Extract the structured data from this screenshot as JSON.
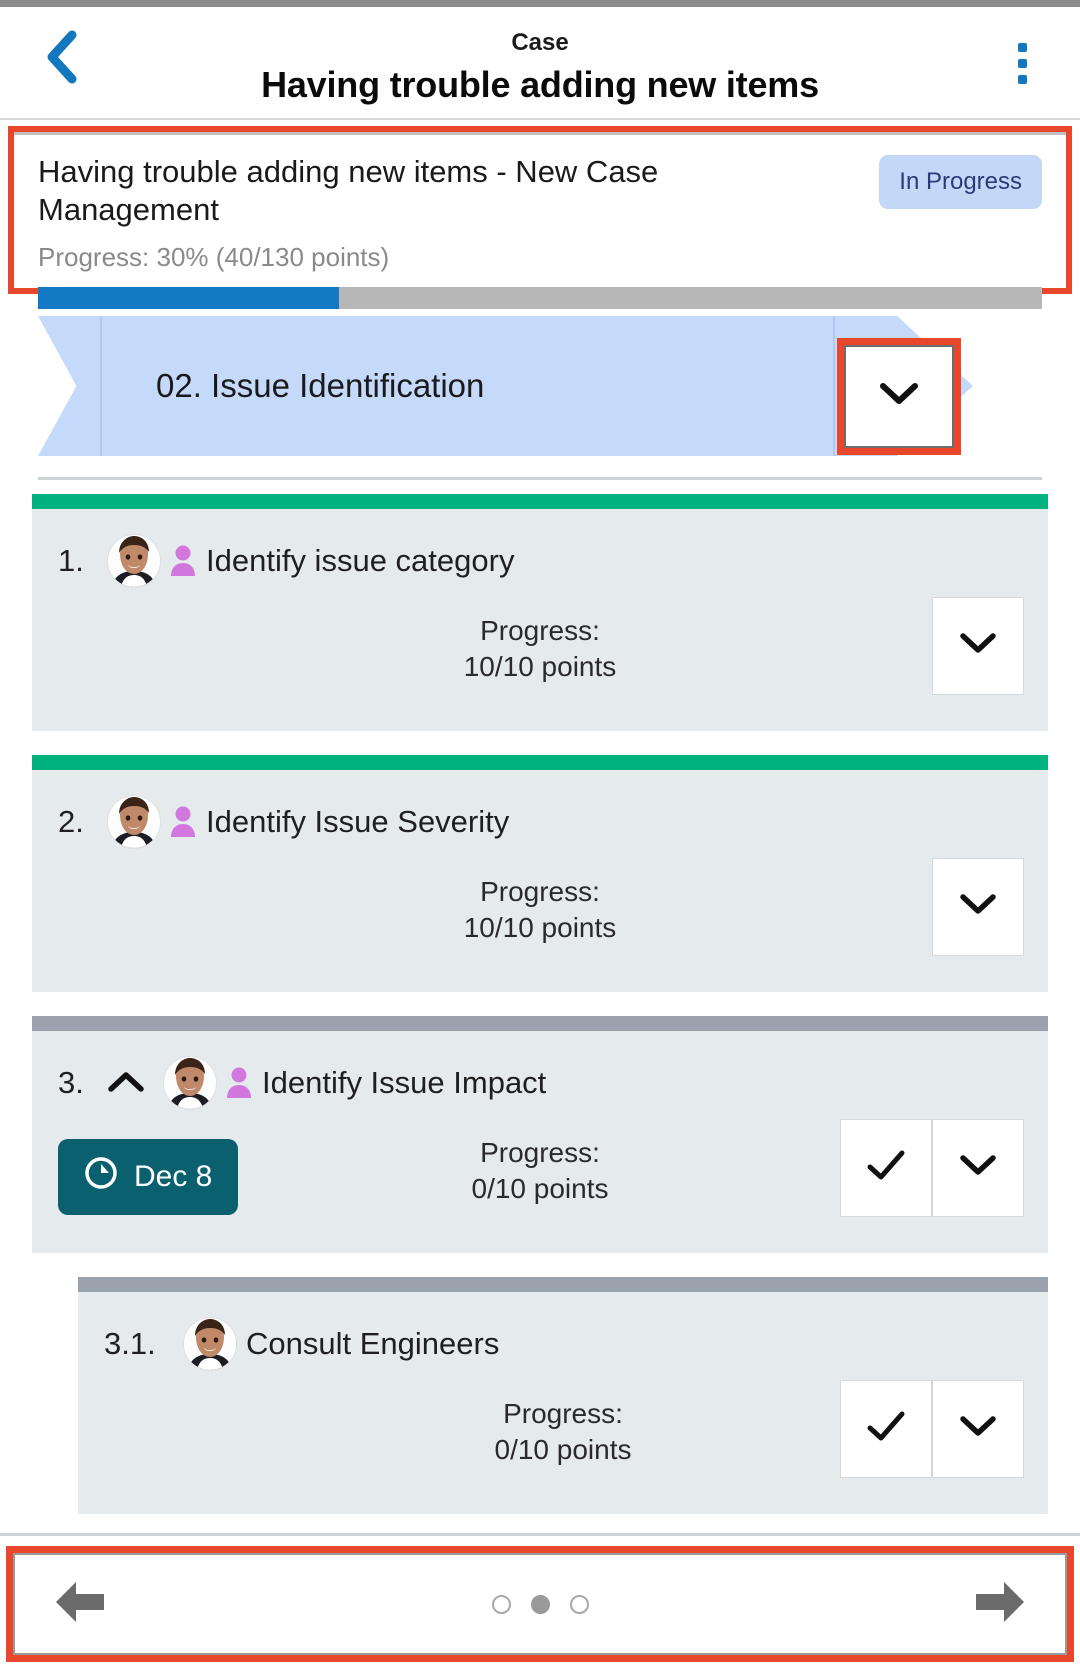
{
  "header": {
    "eyebrow": "Case",
    "title": "Having trouble adding new items",
    "back_icon": "chevron-left-icon",
    "menu_icon": "kebab-menu-icon"
  },
  "summary": {
    "title": "Having trouble adding new items - New Case Management",
    "status": "In Progress",
    "progress_label": "Progress: 30% (40/130 points)",
    "progress_percent": 30,
    "fill_color": "#1479c4",
    "track_color": "#b7b7b7",
    "badge_bg": "#c3d8f7",
    "badge_fg": "#2c3a78"
  },
  "stage": {
    "label": "02. Issue Identification",
    "toggle_icon": "chevron-down-icon",
    "banner_color": "#c5d9fb"
  },
  "tasks": [
    {
      "number": "1.",
      "name": "Identify issue category",
      "top_bar_color": "#00b37e",
      "progress_label": "Progress:",
      "progress_points": "10/10 points",
      "has_person_icon": true,
      "has_collapse_chevron": false,
      "date": null,
      "actions": [
        "chevron-down-icon"
      ],
      "is_sub": false
    },
    {
      "number": "2.",
      "name": "Identify Issue Severity",
      "top_bar_color": "#00b37e",
      "progress_label": "Progress:",
      "progress_points": "10/10 points",
      "has_person_icon": true,
      "has_collapse_chevron": false,
      "date": null,
      "actions": [
        "chevron-down-icon"
      ],
      "is_sub": false
    },
    {
      "number": "3.",
      "name": "Identify Issue Impact",
      "top_bar_color": "#9aa2ad",
      "progress_label": "Progress:",
      "progress_points": "0/10 points",
      "has_person_icon": true,
      "has_collapse_chevron": true,
      "date": "Dec 8",
      "date_icon": "clock-icon",
      "date_bg": "#0b6070",
      "actions": [
        "check-icon",
        "chevron-down-icon"
      ],
      "is_sub": false
    },
    {
      "number": "3.1.",
      "name": "Consult Engineers",
      "top_bar_color": "#9aa2ad",
      "progress_label": "Progress:",
      "progress_points": "0/10 points",
      "has_person_icon": false,
      "has_collapse_chevron": false,
      "date": null,
      "actions": [
        "check-icon",
        "chevron-down-icon"
      ],
      "is_sub": true
    }
  ],
  "bottom_nav": {
    "prev_icon": "arrow-left-icon",
    "next_icon": "arrow-right-icon",
    "dots_total": 3,
    "dots_active_index": 1
  },
  "highlight_color": "#e8472b"
}
